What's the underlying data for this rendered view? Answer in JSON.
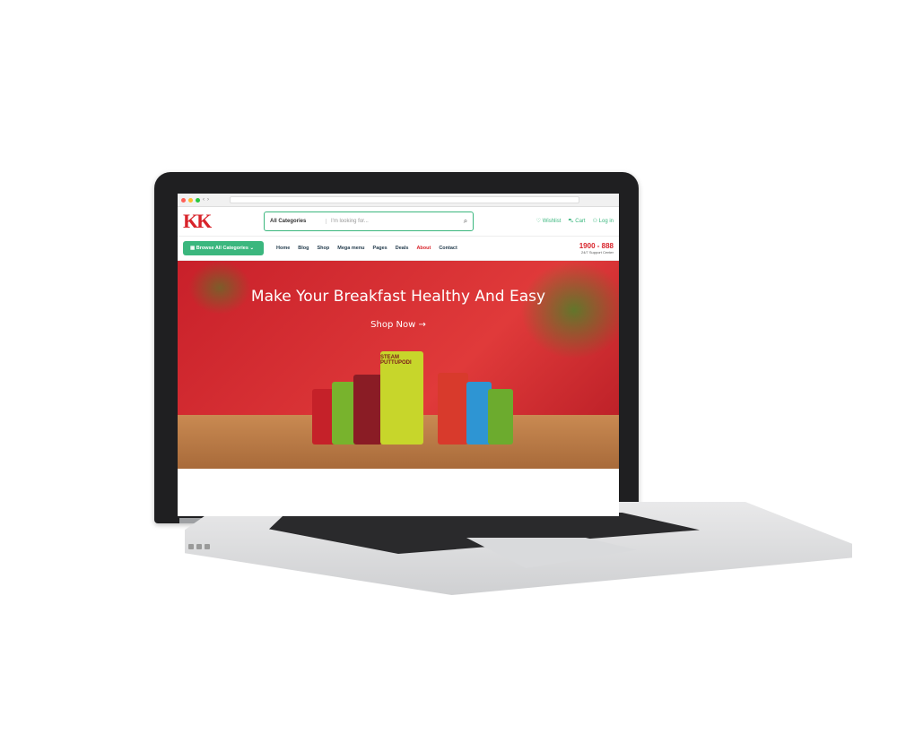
{
  "browser": {
    "url": ""
  },
  "header": {
    "logo_text": "KK",
    "search_category": "All Categories",
    "search_placeholder": "I'm looking for...",
    "wishlist": "Wishlist",
    "cart": "Cart",
    "login": "Log in"
  },
  "nav": {
    "browse_label": "Browse All Categories",
    "items": [
      "Home",
      "Blog",
      "Shop",
      "Mega menu",
      "Pages",
      "Deals",
      "About",
      "Contact"
    ],
    "phone": "1900 - 888",
    "support": "24/7 Support Center"
  },
  "hero": {
    "headline": "Make Your Breakfast Healthy And Easy",
    "cta": "Shop Now →",
    "product_label": "STEAM PUTTUPODI"
  },
  "colors": {
    "brand_red": "#d8232a",
    "accent_green": "#3bb77e"
  }
}
